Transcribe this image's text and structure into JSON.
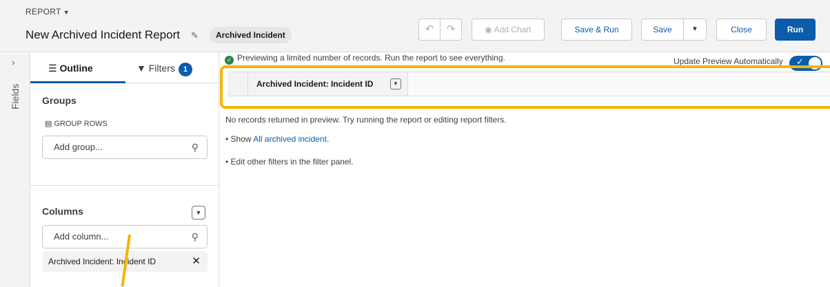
{
  "header": {
    "report_label": "REPORT",
    "title": "New Archived Incident Report",
    "report_type": "Archived Incident",
    "buttons": {
      "undo_icon": "undo-icon",
      "redo_icon": "redo-icon",
      "add_chart": "Add Chart",
      "save_and_run": "Save & Run",
      "save": "Save",
      "close": "Close",
      "run": "Run"
    }
  },
  "fields_rail": {
    "label": "Fields"
  },
  "left_panel": {
    "tabs": [
      {
        "label": "Outline",
        "icon": "list-icon",
        "active": true
      },
      {
        "label": "Filters",
        "icon": "filter-icon",
        "count": "1"
      }
    ],
    "groups": {
      "title": "Groups",
      "sub_label": "GROUP ROWS",
      "placeholder": "Add group..."
    },
    "columns": {
      "title": "Columns",
      "placeholder": "Add column...",
      "items": [
        "Archived Incident: Incident ID"
      ]
    }
  },
  "preview": {
    "notice": "Previewing a limited number of records. Run the report to see everything.",
    "update_label": "Update Preview Automatically",
    "update_enabled": true,
    "column_header": "Archived Incident: Incident ID",
    "empty_message": "No records returned in preview. Try running the report or editing report filters.",
    "show_prefix": "• Show ",
    "show_link": "All archived incident",
    "show_suffix": ".",
    "edit_hint": "• Edit other filters in the filter panel."
  },
  "colors": {
    "accent": "#0b5cab",
    "highlight": "#f5b400",
    "success": "#2e844a"
  }
}
